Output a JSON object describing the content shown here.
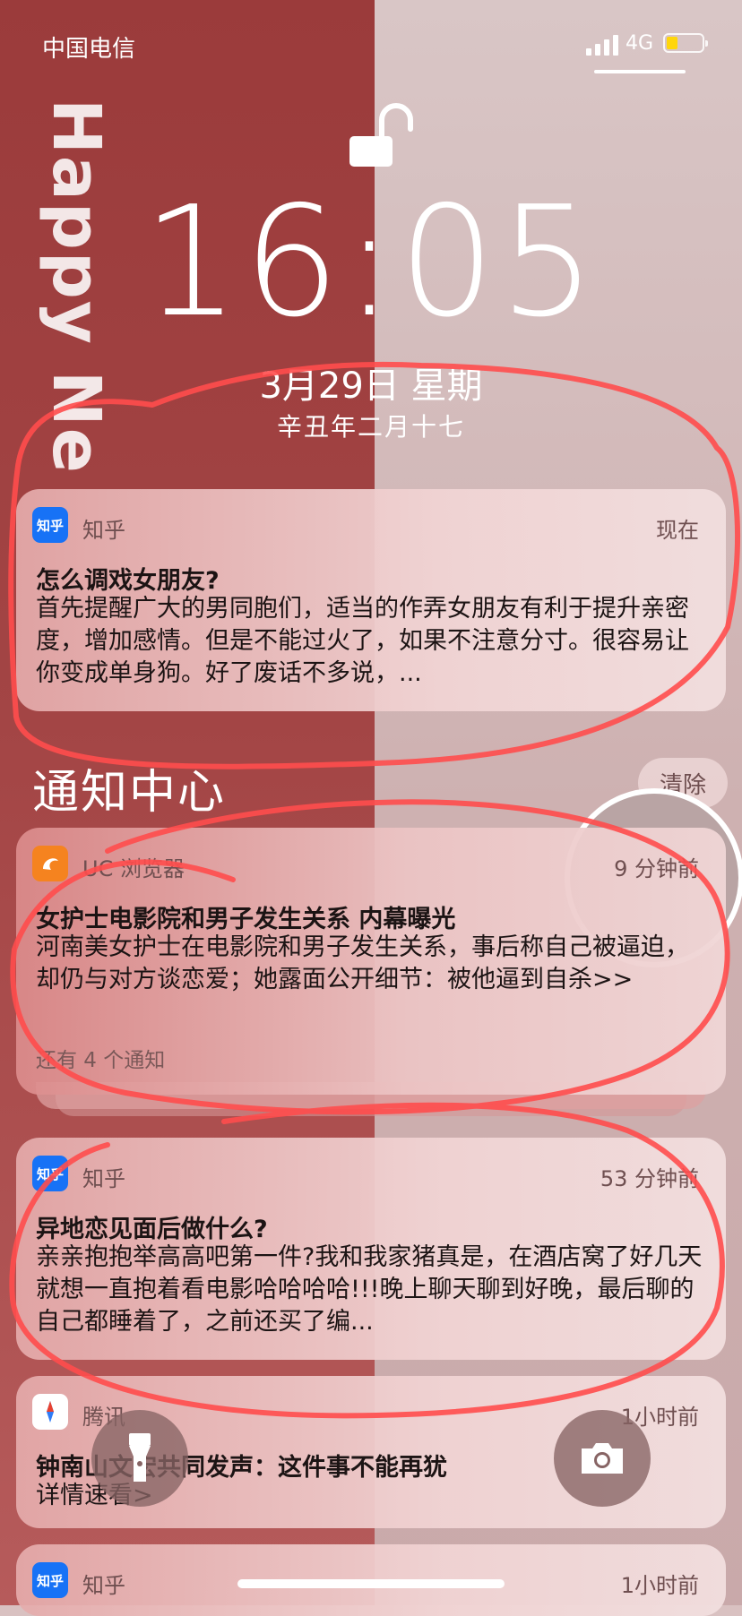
{
  "wallpaper": {
    "text": "Happy Ne",
    "left_color": "#a34545",
    "right_color": "#d3b9b9"
  },
  "status_bar": {
    "carrier": "中国电信",
    "network": "4G",
    "battery_color": "#ffd60a"
  },
  "lock": {
    "icon": "unlocked-padlock-icon"
  },
  "clock": {
    "time": "16:05",
    "date": "3月29日 星期",
    "lunar": "辛丑年二月十七"
  },
  "notification_center": {
    "title": "通知中心",
    "clear_label": "清除"
  },
  "notifications": [
    {
      "app": "知乎",
      "icon_text": "知乎",
      "time": "现在",
      "title": "怎么调戏女朋友?",
      "body": "首先提醒广大的男同胞们，适当的作弄女朋友有利于提升亲密度，增加感情。但是不能过火了，如果不注意分寸。很容易让你变成单身狗。好了废话不多说，..."
    },
    {
      "app": "UC 浏览器",
      "time": "9 分钟前",
      "title": "女护士电影院和男子发生关系 内幕曝光",
      "body": "河南美女护士在电影院和男子发生关系，事后称自己被逼迫，却仍与对方谈恋爱；她露面公开细节：被他逼到自杀>>",
      "more": "还有 4 个通知"
    },
    {
      "app": "知乎",
      "icon_text": "知乎",
      "time": "53 分钟前",
      "title": "异地恋见面后做什么?",
      "body": "亲亲抱抱举高高吧第一件?我和我家猪真是，在酒店窝了好几天就想一直抱着看电影哈哈哈哈!!!晚上聊天聊到好晚，最后聊的自己都睡着了，之前还买了编..."
    },
    {
      "app": "腾讯",
      "time": "1小时前",
      "title": "钟南山文宏共同发声：这件事不能再犹",
      "body": "详情速看>"
    },
    {
      "app": "知乎",
      "icon_text": "知乎",
      "time": "1小时前"
    }
  ],
  "bottom": {
    "left_icon": "flashlight-icon",
    "right_icon": "camera-icon"
  },
  "annotation": {
    "color": "#ff4d4d"
  }
}
